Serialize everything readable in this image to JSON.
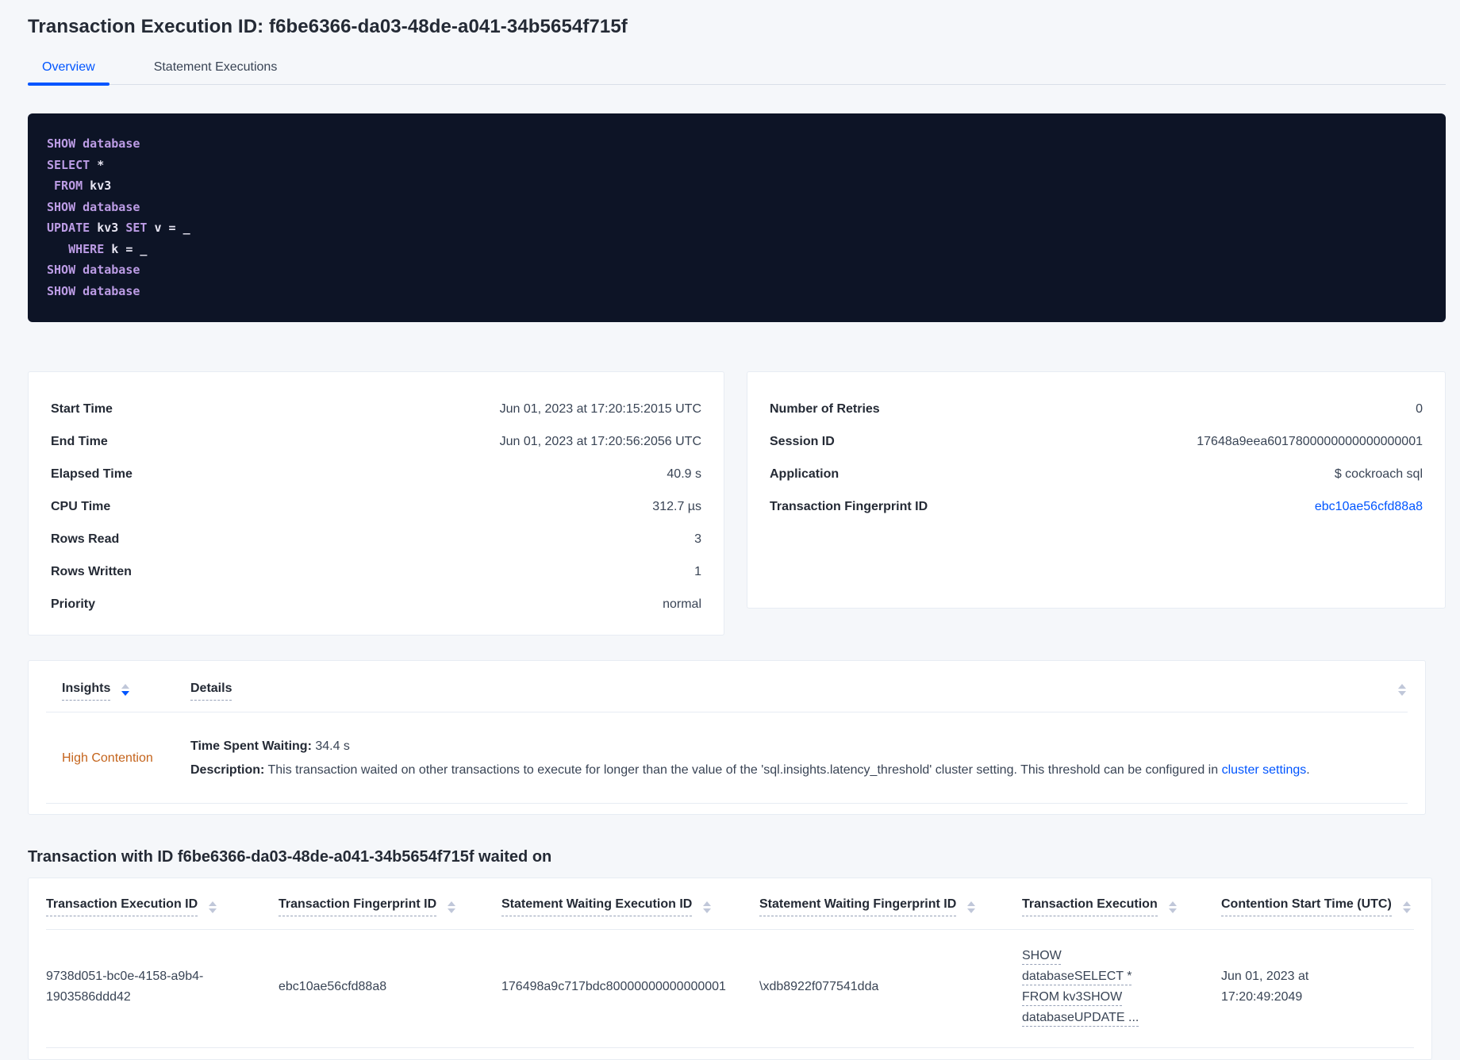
{
  "page": {
    "title": "Transaction Execution ID: f6be6366-da03-48de-a041-34b5654f715f"
  },
  "tabs": [
    {
      "label": "Overview",
      "active": true
    },
    {
      "label": "Statement Executions",
      "active": false
    }
  ],
  "sql_box": {
    "lines": [
      [
        {
          "t": "SHOW",
          "k": true
        },
        {
          "t": " "
        },
        {
          "t": "database",
          "k": true
        }
      ],
      [
        {
          "t": "SELECT",
          "k": true
        },
        {
          "t": " *"
        }
      ],
      [
        {
          "t": " "
        },
        {
          "t": "FROM",
          "k": true
        },
        {
          "t": " kv3"
        }
      ],
      [
        {
          "t": "SHOW",
          "k": true
        },
        {
          "t": " "
        },
        {
          "t": "database",
          "k": true
        }
      ],
      [
        {
          "t": "UPDATE",
          "k": true
        },
        {
          "t": " kv3 "
        },
        {
          "t": "SET",
          "k": true
        },
        {
          "t": " v = _"
        }
      ],
      [
        {
          "t": "   "
        },
        {
          "t": "WHERE",
          "k": true
        },
        {
          "t": " k = _"
        }
      ],
      [
        {
          "t": "SHOW",
          "k": true
        },
        {
          "t": " "
        },
        {
          "t": "database",
          "k": true
        }
      ],
      [
        {
          "t": "SHOW",
          "k": true
        },
        {
          "t": " "
        },
        {
          "t": "database",
          "k": true
        }
      ]
    ]
  },
  "left_card": {
    "rows": [
      {
        "label": "Start Time",
        "value": "Jun 01, 2023 at 17:20:15:2015 UTC"
      },
      {
        "label": "End Time",
        "value": "Jun 01, 2023 at 17:20:56:2056 UTC"
      },
      {
        "label": "Elapsed Time",
        "value": "40.9 s"
      },
      {
        "label": "CPU Time",
        "value": "312.7 µs"
      },
      {
        "label": "Rows Read",
        "value": "3"
      },
      {
        "label": "Rows Written",
        "value": "1"
      },
      {
        "label": "Priority",
        "value": "normal"
      }
    ]
  },
  "right_card": {
    "rows": [
      {
        "label": "Number of Retries",
        "value": "0"
      },
      {
        "label": "Session ID",
        "value": "17648a9eea6017800000000000000001"
      },
      {
        "label": "Application",
        "value": "$ cockroach sql"
      },
      {
        "label": "Transaction Fingerprint ID",
        "value": "ebc10ae56cfd88a8",
        "link": true
      }
    ]
  },
  "insights": {
    "headers": {
      "insights": "Insights",
      "details": "Details"
    },
    "row": {
      "insight": "High Contention",
      "waiting_label": "Time Spent Waiting:",
      "waiting_value": " 34.4 s",
      "desc_label": "Description:",
      "desc_text": " This transaction waited on other transactions to execute for longer than the value of the 'sql.insights.latency_threshold' cluster setting. This threshold can be configured in ",
      "desc_link": "cluster settings",
      "desc_suffix": "."
    }
  },
  "waited_on": {
    "heading": "Transaction with ID f6be6366-da03-48de-a041-34b5654f715f waited on",
    "columns": [
      "Transaction Execution ID",
      "Transaction Fingerprint ID",
      "Statement Waiting Execution ID",
      "Statement Waiting Fingerprint ID",
      "Transaction Execution",
      "Contention Start Time (UTC)"
    ],
    "row": {
      "txn_execution_id": "9738d051-bc0e-4158-a9b4-1903586ddd42",
      "txn_fingerprint_id": "ebc10ae56cfd88a8",
      "stmt_waiting_execution_id": "176498a9c717bdc80000000000000001",
      "stmt_waiting_fingerprint_id": "\\xdb8922f077541dda",
      "txn_execution": "SHOW databaseSELECT * FROM kv3SHOW databaseUPDATE ...",
      "contention_start": "Jun 01, 2023 at 17:20:49:2049"
    }
  },
  "colors": {
    "accent_blue": "#0055ff",
    "insight_orange": "#c4641c",
    "code_background": "#0d1426",
    "code_keyword": "#bc9ce5",
    "code_plain": "#e7e5f2"
  }
}
